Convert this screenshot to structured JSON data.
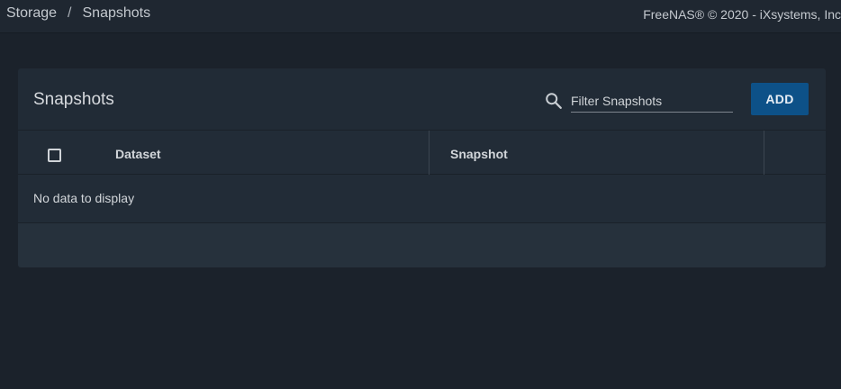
{
  "breadcrumb": {
    "items": [
      "Storage",
      "Snapshots"
    ],
    "separator": "/"
  },
  "copyright": "FreeNAS® © 2020 - iXsystems, Inc",
  "card": {
    "title": "Snapshots",
    "search": {
      "icon": "search-icon",
      "placeholder": "Filter Snapshots",
      "value": ""
    },
    "add_label": "ADD"
  },
  "table": {
    "columns": [
      "Dataset",
      "Snapshot"
    ],
    "rows": [],
    "empty_text": "No data to display"
  },
  "colors": {
    "background": "#1b222b",
    "topbar": "#1f2731",
    "card": "#212b36",
    "accent": "#0d5188"
  }
}
